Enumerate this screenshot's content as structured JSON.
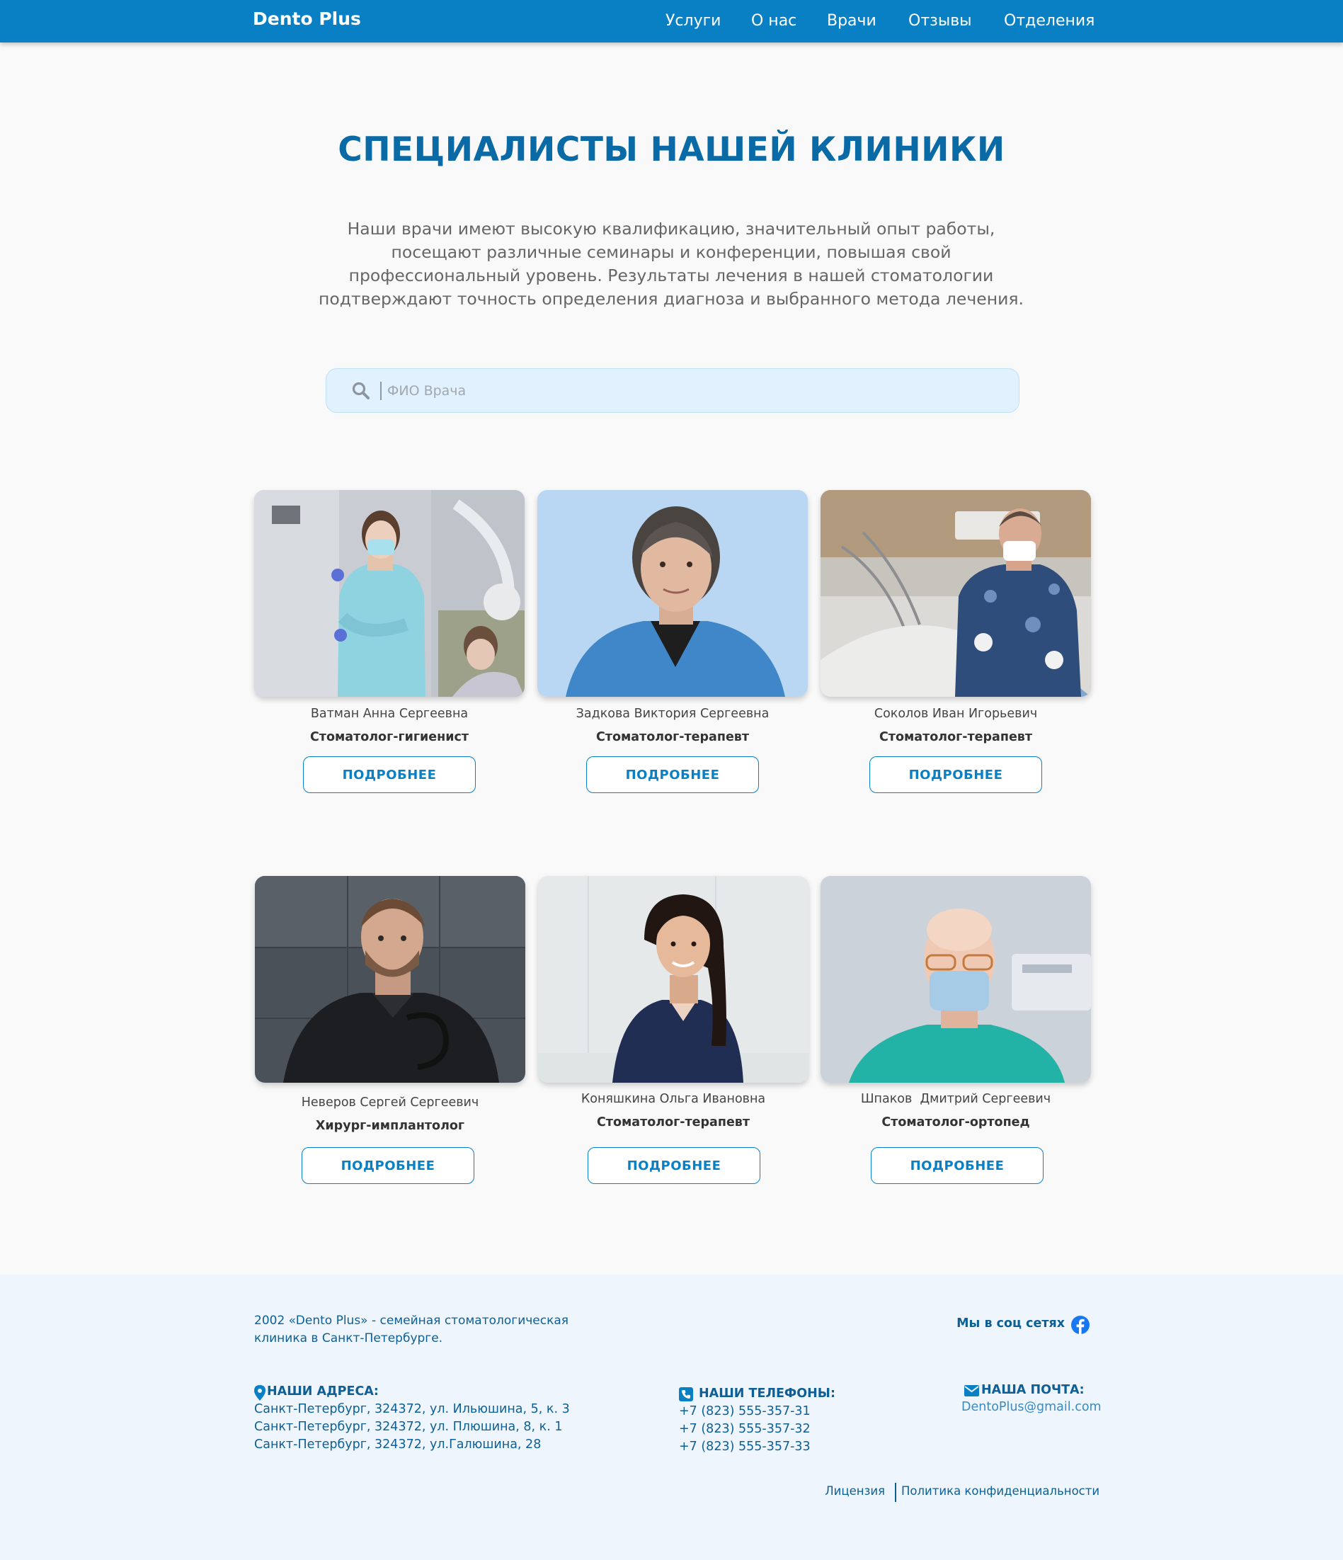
{
  "header": {
    "logo": "Dento Plus",
    "nav": [
      "Услуги",
      "О нас",
      "Врачи",
      "Отзывы",
      "Отделения"
    ]
  },
  "hero": {
    "title": "СПЕЦИАЛИСТЫ НАШЕЙ КЛИНИКИ",
    "lead_lines": [
      "Наши врачи имеют высокую квалификацию, значительный опыт работы,",
      "посещают различные семинары и конференции, повышая свой",
      "профессиональный уровень. Результаты лечения в нашей стоматологии",
      "подтверждают точность определения диагноза и выбранного метода лечения."
    ]
  },
  "search": {
    "placeholder": "ФИО Врача",
    "icon": "search-icon"
  },
  "doctors": [
    {
      "name": "Ватман Анна Сергеевна",
      "role": "Стоматолог-гигиенист",
      "button": "ПОДРОБНЕЕ"
    },
    {
      "name": "Задкова Виктория Сергеевна",
      "role": "Стоматолог-терапевт",
      "button": "ПОДРОБНЕЕ"
    },
    {
      "name": "Соколов Иван Игорьевич",
      "role": "Стоматолог-терапевт",
      "button": "ПОДРОБНЕЕ"
    },
    {
      "name": "Неверов Сергей Сергеевич",
      "role": "Хирург-имплантолог",
      "button": "ПОДРОБНЕЕ"
    },
    {
      "name": "Коняшкина Ольга Ивановна",
      "role": "Стоматолог-терапевт",
      "button": "ПОДРОБНЕЕ"
    },
    {
      "name": "Шпаков  Дмитрий Сергеевич",
      "role": "Стоматолог-ортопед",
      "button": "ПОДРОБНЕЕ"
    }
  ],
  "footer": {
    "about_lines": [
      "2002 «Dento Plus» - семейная стоматологическая",
      "клиника в Санкт-Петербурге."
    ],
    "social_label": "Мы в соц сетях",
    "social_icon": "facebook-icon",
    "addresses_title": "НАШИ АДРЕСА:",
    "addresses": [
      "Санкт-Петербург, 324372, ул. Ильюшина, 5, к. 3",
      "Санкт-Петербург, 324372, ул. Плюшина, 8, к. 1",
      "Санкт-Петербург, 324372, ул.Галюшина, 28"
    ],
    "phones_title": "НАШИ ТЕЛЕФОНЫ:",
    "phones": [
      "+7 (823) 555-357-31",
      "+7 (823) 555-357-32",
      "+7 (823) 555-357-33"
    ],
    "mail_title": "НАША ПОЧТА:",
    "mail": "DentoPlus@gmail.com",
    "links": [
      "Лицензия",
      "Политика конфиденциальности"
    ]
  },
  "colors": {
    "brand": "#0a80c4",
    "title": "#0a6aa6",
    "footer_text": "#0d5f95",
    "search_bg": "#e1f1fd",
    "footer_bg": "#eef5fc"
  }
}
